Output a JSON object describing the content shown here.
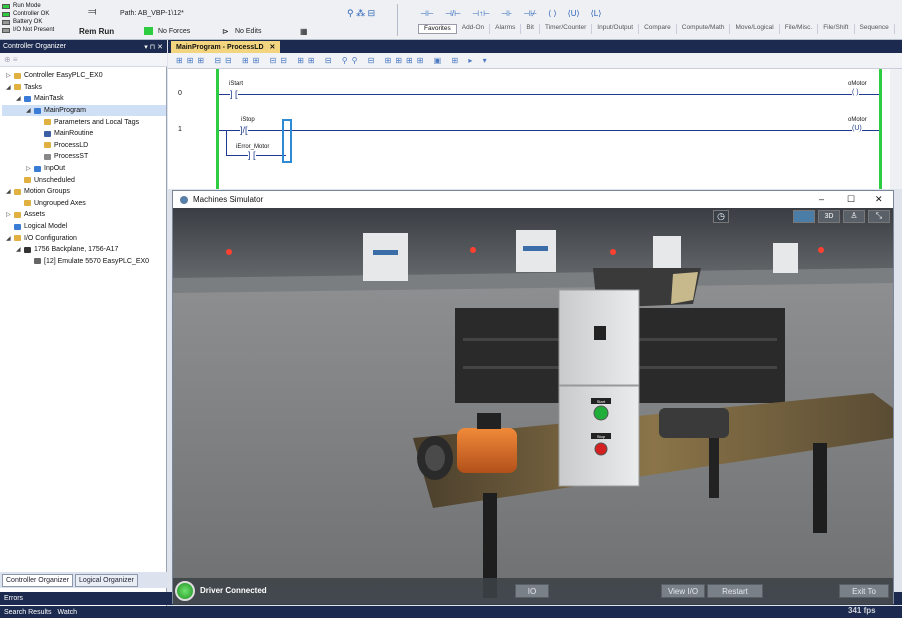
{
  "status": {
    "run_mode": "Run Mode",
    "controller_ok": "Controller OK",
    "battery_ok": "Battery OK",
    "io": "I/O Not Present",
    "rem_run": "Rem Run",
    "no_forces": "No Forces",
    "no_edits": "No Edits",
    "path_label": "Path:",
    "path_value": "AB_VBP-1\\12*"
  },
  "colors": {
    "green": "#2ecc40",
    "navy": "#1b2a4e",
    "rung": "#1f3a8f"
  },
  "instr_tabs": [
    "Favorites",
    "Add-On",
    "Alarms",
    "Bit",
    "Timer/Counter",
    "Input/Output",
    "Compare",
    "Compute/Math",
    "Move/Logical",
    "File/Misc.",
    "File/Shift",
    "Sequence"
  ],
  "instr_symbols": [
    "⊣⊢",
    "⊣/⊢",
    "⊣↑⊢",
    "⊣⊦",
    "⊣⊬",
    "⟨ ⟩",
    "⟨U⟩",
    "⟨L⟩"
  ],
  "organizer": {
    "title": "Controller Organizer",
    "pin": "▾ ⊓ ✕",
    "tree": [
      {
        "label": "Controller EasyPLC_EX0",
        "indent": 0,
        "exp": "▷",
        "icon": "#e0b040"
      },
      {
        "label": "Tasks",
        "indent": 0,
        "exp": "◢",
        "icon": "#e0b040"
      },
      {
        "label": "MainTask",
        "indent": 1,
        "exp": "◢",
        "icon": "#3a7bd5"
      },
      {
        "label": "MainProgram",
        "indent": 2,
        "exp": "◢",
        "icon": "#3a7bd5",
        "sel": true
      },
      {
        "label": "Parameters and Local Tags",
        "indent": 3,
        "exp": "",
        "icon": "#e0b040"
      },
      {
        "label": "MainRoutine",
        "indent": 3,
        "exp": "",
        "icon": "#3a5fa5"
      },
      {
        "label": "ProcessLD",
        "indent": 3,
        "exp": "",
        "icon": "#e0b040"
      },
      {
        "label": "ProcessST",
        "indent": 3,
        "exp": "",
        "icon": "#888888"
      },
      {
        "label": "InpOut",
        "indent": 2,
        "exp": "▷",
        "icon": "#3a7bd5"
      },
      {
        "label": "Unscheduled",
        "indent": 1,
        "exp": "",
        "icon": "#e0b040"
      },
      {
        "label": "Motion Groups",
        "indent": 0,
        "exp": "◢",
        "icon": "#e0b040"
      },
      {
        "label": "Ungrouped Axes",
        "indent": 1,
        "exp": "",
        "icon": "#e0b040"
      },
      {
        "label": "Assets",
        "indent": 0,
        "exp": "▷",
        "icon": "#e0b040"
      },
      {
        "label": "Logical Model",
        "indent": 0,
        "exp": "",
        "icon": "#3a7bd5"
      },
      {
        "label": "I/O Configuration",
        "indent": 0,
        "exp": "◢",
        "icon": "#e0b040"
      },
      {
        "label": "1756 Backplane, 1756-A17",
        "indent": 1,
        "exp": "◢",
        "icon": "#333333"
      },
      {
        "label": "[12] Emulate 5570 EasyPLC_EX0",
        "indent": 2,
        "exp": "",
        "icon": "#666666"
      }
    ],
    "tabs": [
      "Controller Organizer",
      "Logical Organizer"
    ]
  },
  "errors_label": "Errors",
  "bottom_tabs": [
    "Search Results",
    "Watch"
  ],
  "ladder": {
    "tab": "MainProgram - ProcessLD",
    "close": "✕",
    "rungs": [
      {
        "num": "0",
        "contact": "iStart",
        "coil": "oMotor",
        "coil_sym": "( )"
      },
      {
        "num": "1",
        "contact": "iStop",
        "branch": "iError_Motor",
        "coil": "oMotor",
        "coil_sym": "(U)"
      }
    ]
  },
  "sim": {
    "title": "Machines Simulator",
    "min": "–",
    "max": "☐",
    "close": "✕",
    "view_btns": [
      "3D"
    ],
    "driver": "Driver Connected",
    "io_btn": "IO",
    "view_io": "View I/O",
    "restart": "Restart",
    "exit": "Exit To",
    "fps": "341 fps",
    "start_plate": "Start",
    "stop_plate": "Stop"
  }
}
